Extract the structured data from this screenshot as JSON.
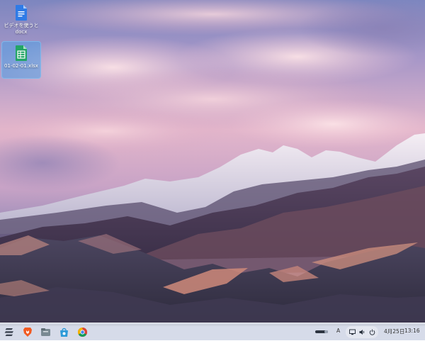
{
  "desktop": {
    "icons": [
      {
        "name": "ビデオを使うと\ndocx",
        "type": "document-icon"
      },
      {
        "name": "01-02-01.xlsx",
        "type": "spreadsheet-icon"
      }
    ]
  },
  "taskbar": {
    "apps": [
      {
        "name": "launcher",
        "icon": "zorin-logo-icon"
      },
      {
        "name": "brave",
        "icon": "brave-browser-icon"
      },
      {
        "name": "files",
        "icon": "file-manager-icon"
      },
      {
        "name": "software",
        "icon": "software-store-icon"
      },
      {
        "name": "chrome",
        "icon": "chrome-icon"
      }
    ],
    "tray": {
      "input_method": "A",
      "date": "4月25日",
      "time": "13:16"
    }
  },
  "colors": {
    "sky_top": "#6f7fb8",
    "sky_pink": "#e9b6c9",
    "mountain_dark": "#3c3450",
    "dune_light": "#c58a7e",
    "taskbar_bg": "#dee4ee"
  }
}
